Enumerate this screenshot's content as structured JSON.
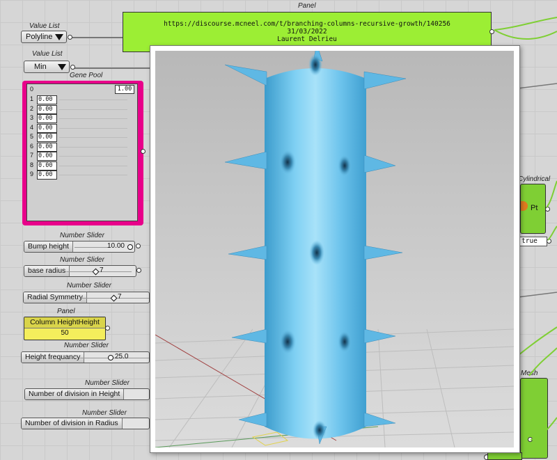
{
  "value_lists": [
    {
      "title": "Value List",
      "value": "Polyline"
    },
    {
      "title": "Value List",
      "value": "Min"
    }
  ],
  "top_panel": {
    "title": "Panel",
    "lines": [
      "https://discourse.mcneel.com/t/branching-columns-recursive-growth/140256",
      "31/03/2022",
      "Laurent Delrieu"
    ]
  },
  "gene_pool": {
    "title": "Gene Pool",
    "top_index": "0",
    "top_value": "1.00",
    "rows": [
      {
        "index": "1",
        "value": "0.00"
      },
      {
        "index": "2",
        "value": "0.00"
      },
      {
        "index": "3",
        "value": "0.00"
      },
      {
        "index": "4",
        "value": "0.00"
      },
      {
        "index": "5",
        "value": "0.00"
      },
      {
        "index": "6",
        "value": "0.00"
      },
      {
        "index": "7",
        "value": "0.00"
      },
      {
        "index": "8",
        "value": "0.00"
      },
      {
        "index": "9",
        "value": "0.00"
      }
    ]
  },
  "sliders": [
    {
      "title": "Number Slider",
      "label": "Bump height",
      "value": "10.00"
    },
    {
      "title": "Number Slider",
      "label": "base radius",
      "value": "7"
    },
    {
      "title": "Number Slider",
      "label": "Radial Symmetry",
      "value": "7"
    },
    {
      "title": "Number Slider",
      "label": "Height frequancy",
      "value": "25.0"
    },
    {
      "title": "Number Slider",
      "label": "Number of division in Height",
      "value": ""
    },
    {
      "title": "Number Slider",
      "label": "Number of division in Radius",
      "value": ""
    }
  ],
  "column_panel": {
    "title": "Panel",
    "header": "Column HeightHeight",
    "value": "50"
  },
  "right_components": {
    "cylindrical_title": "Cylindrical",
    "cylindrical_output": "Pt",
    "boolean_value": "true",
    "mesh_title": "Mesh"
  },
  "colors": {
    "column": "#67c3ea",
    "panel_green": "#9cee34",
    "gene_pink": "#e8008a",
    "viewport_bg": "#c8c8c8"
  }
}
